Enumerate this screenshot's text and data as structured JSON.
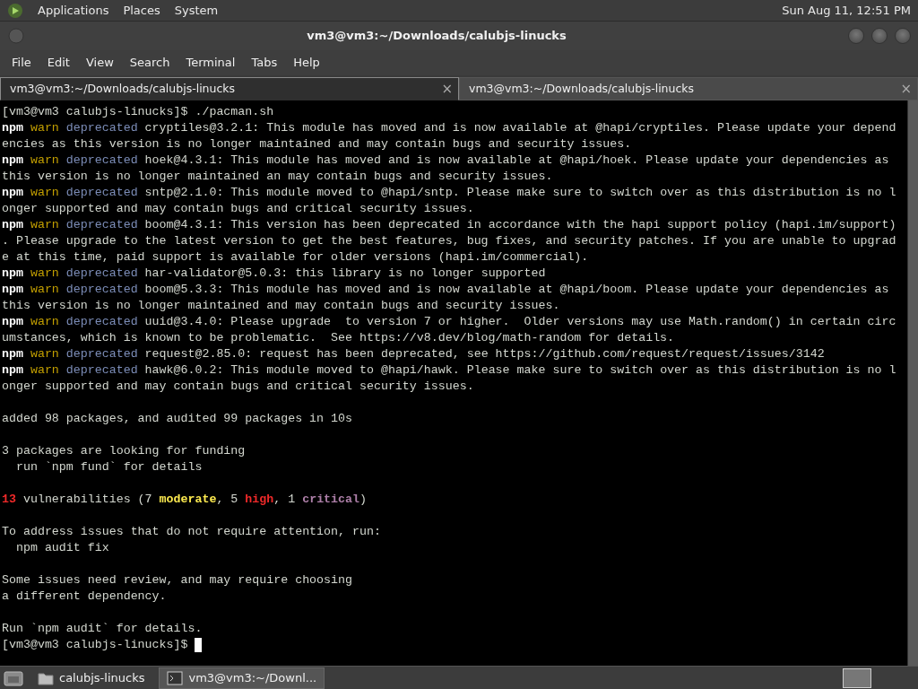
{
  "top_panel": {
    "menus": [
      "Applications",
      "Places",
      "System"
    ],
    "clock": "Sun Aug 11, 12:51 PM"
  },
  "window": {
    "title": "vm3@vm3:~/Downloads/calubjs-linucks"
  },
  "menubar": [
    "File",
    "Edit",
    "View",
    "Search",
    "Terminal",
    "Tabs",
    "Help"
  ],
  "tabs": [
    {
      "label": "vm3@vm3:~/Downloads/calubjs-linucks",
      "close": "×",
      "selected": true
    },
    {
      "label": "vm3@vm3:~/Downloads/calubjs-linucks",
      "close": "×",
      "selected": false
    }
  ],
  "terminal": {
    "lines": [
      {
        "segments": [
          {
            "kind": "plain",
            "text": "[vm3@vm3 calubjs-linucks]$ ./pacman.sh"
          }
        ]
      },
      {
        "segments": [
          {
            "kind": "npm",
            "text": "npm"
          },
          {
            "kind": "warn",
            "text": " warn"
          },
          {
            "kind": "deprecated",
            "text": " deprecated"
          },
          {
            "kind": "plain",
            "text": " cryptiles@3.2.1: This module has moved and is now available at @hapi/cryptiles. Please update your depend"
          }
        ]
      },
      {
        "segments": [
          {
            "kind": "plain",
            "text": "encies as this version is no longer maintained and may contain bugs and security issues."
          }
        ]
      },
      {
        "segments": [
          {
            "kind": "npm",
            "text": "npm"
          },
          {
            "kind": "warn",
            "text": " warn"
          },
          {
            "kind": "deprecated",
            "text": " deprecated"
          },
          {
            "kind": "plain",
            "text": " hoek@4.3.1: This module has moved and is now available at @hapi/hoek. Please update your dependencies as"
          }
        ]
      },
      {
        "segments": [
          {
            "kind": "plain",
            "text": "this version is no longer maintained an may contain bugs and security issues."
          }
        ]
      },
      {
        "segments": [
          {
            "kind": "npm",
            "text": "npm"
          },
          {
            "kind": "warn",
            "text": " warn"
          },
          {
            "kind": "deprecated",
            "text": " deprecated"
          },
          {
            "kind": "plain",
            "text": " sntp@2.1.0: This module moved to @hapi/sntp. Please make sure to switch over as this distribution is no l"
          }
        ]
      },
      {
        "segments": [
          {
            "kind": "plain",
            "text": "onger supported and may contain bugs and critical security issues."
          }
        ]
      },
      {
        "segments": [
          {
            "kind": "npm",
            "text": "npm"
          },
          {
            "kind": "warn",
            "text": " warn"
          },
          {
            "kind": "deprecated",
            "text": " deprecated"
          },
          {
            "kind": "plain",
            "text": " boom@4.3.1: This version has been deprecated in accordance with the hapi support policy (hapi.im/support)"
          }
        ]
      },
      {
        "segments": [
          {
            "kind": "plain",
            "text": ". Please upgrade to the latest version to get the best features, bug fixes, and security patches. If you are unable to upgrad"
          }
        ]
      },
      {
        "segments": [
          {
            "kind": "plain",
            "text": "e at this time, paid support is available for older versions (hapi.im/commercial)."
          }
        ]
      },
      {
        "segments": [
          {
            "kind": "npm",
            "text": "npm"
          },
          {
            "kind": "warn",
            "text": " warn"
          },
          {
            "kind": "deprecated",
            "text": " deprecated"
          },
          {
            "kind": "plain",
            "text": " har-validator@5.0.3: this library is no longer supported"
          }
        ]
      },
      {
        "segments": [
          {
            "kind": "npm",
            "text": "npm"
          },
          {
            "kind": "warn",
            "text": " warn"
          },
          {
            "kind": "deprecated",
            "text": " deprecated"
          },
          {
            "kind": "plain",
            "text": " boom@5.3.3: This module has moved and is now available at @hapi/boom. Please update your dependencies as"
          }
        ]
      },
      {
        "segments": [
          {
            "kind": "plain",
            "text": "this version is no longer maintained and may contain bugs and security issues."
          }
        ]
      },
      {
        "segments": [
          {
            "kind": "npm",
            "text": "npm"
          },
          {
            "kind": "warn",
            "text": " warn"
          },
          {
            "kind": "deprecated",
            "text": " deprecated"
          },
          {
            "kind": "plain",
            "text": " uuid@3.4.0: Please upgrade  to version 7 or higher.  Older versions may use Math.random() in certain circ"
          }
        ]
      },
      {
        "segments": [
          {
            "kind": "plain",
            "text": "umstances, which is known to be problematic.  See https://v8.dev/blog/math-random for details."
          }
        ]
      },
      {
        "segments": [
          {
            "kind": "npm",
            "text": "npm"
          },
          {
            "kind": "warn",
            "text": " warn"
          },
          {
            "kind": "deprecated",
            "text": " deprecated"
          },
          {
            "kind": "plain",
            "text": " request@2.85.0: request has been deprecated, see https://github.com/request/request/issues/3142"
          }
        ]
      },
      {
        "segments": [
          {
            "kind": "npm",
            "text": "npm"
          },
          {
            "kind": "warn",
            "text": " warn"
          },
          {
            "kind": "deprecated",
            "text": " deprecated"
          },
          {
            "kind": "plain",
            "text": " hawk@6.0.2: This module moved to @hapi/hawk. Please make sure to switch over as this distribution is no l"
          }
        ]
      },
      {
        "segments": [
          {
            "kind": "plain",
            "text": "onger supported and may contain bugs and critical security issues."
          }
        ]
      },
      {
        "blank_before": true,
        "segments": [
          {
            "kind": "plain",
            "text": "added 98 packages, and audited 99 packages in 10s"
          }
        ]
      },
      {
        "blank_before": true,
        "segments": [
          {
            "kind": "plain",
            "text": "3 packages are looking for funding"
          }
        ]
      },
      {
        "segments": [
          {
            "kind": "plain",
            "text": "  run `npm fund` for details"
          }
        ]
      },
      {
        "blank_before": true,
        "segments": [
          {
            "kind": "high",
            "text": "13"
          },
          {
            "kind": "plain",
            "text": " vulnerabilities (7 "
          },
          {
            "kind": "moderate",
            "text": "moderate"
          },
          {
            "kind": "plain",
            "text": ", 5 "
          },
          {
            "kind": "high",
            "text": "high"
          },
          {
            "kind": "plain",
            "text": ", 1 "
          },
          {
            "kind": "critical",
            "text": "critical"
          },
          {
            "kind": "plain",
            "text": ")"
          }
        ]
      },
      {
        "blank_before": true,
        "segments": [
          {
            "kind": "plain",
            "text": "To address issues that do not require attention, run:"
          }
        ]
      },
      {
        "segments": [
          {
            "kind": "plain",
            "text": "  npm audit fix"
          }
        ]
      },
      {
        "blank_before": true,
        "segments": [
          {
            "kind": "plain",
            "text": "Some issues need review, and may require choosing"
          }
        ]
      },
      {
        "segments": [
          {
            "kind": "plain",
            "text": "a different dependency."
          }
        ]
      },
      {
        "blank_before": true,
        "segments": [
          {
            "kind": "plain",
            "text": "Run `npm audit` for details."
          }
        ]
      },
      {
        "segments": [
          {
            "kind": "plain",
            "text": "[vm3@vm3 calubjs-linucks]$ "
          }
        ],
        "cursor": true
      }
    ]
  },
  "taskbar": {
    "tasks": [
      {
        "kind": "folder",
        "label": "calubjs-linucks",
        "selected": false
      },
      {
        "kind": "terminal",
        "label": "vm3@vm3:~/Downl...",
        "selected": true
      }
    ]
  }
}
